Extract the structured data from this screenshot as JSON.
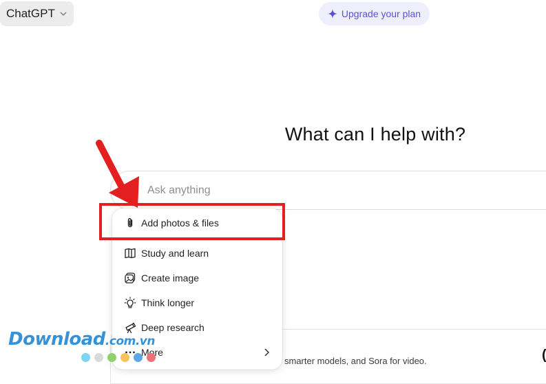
{
  "header": {
    "model_selector": "ChatGPT",
    "upgrade_label": "Upgrade your plan"
  },
  "main": {
    "heading": "What can I help with?",
    "composer": {
      "placeholder": "Ask anything"
    }
  },
  "attach_menu": {
    "items": [
      {
        "label": "Add photos & files",
        "icon": "paperclip-icon"
      },
      {
        "label": "Study and learn",
        "icon": "book-icon"
      },
      {
        "label": "Create image",
        "icon": "image-icon"
      },
      {
        "label": "Think longer",
        "icon": "lightbulb-icon"
      },
      {
        "label": "Deep research",
        "icon": "telescope-icon"
      },
      {
        "label": "More",
        "icon": "ellipsis-icon"
      }
    ]
  },
  "banner": {
    "text": "smarter models, and Sora for video."
  },
  "watermark": {
    "brand": "Download",
    "domain": ".com.vn",
    "dot_colors": [
      "#7fd3f4",
      "#d9d9d9",
      "#8fd16b",
      "#f7c35a",
      "#5aa9e6",
      "#f0707a"
    ]
  },
  "colors": {
    "accent": "#5b51d8",
    "annotation": "#e41f1f",
    "watermark": "#2b8dd6"
  }
}
